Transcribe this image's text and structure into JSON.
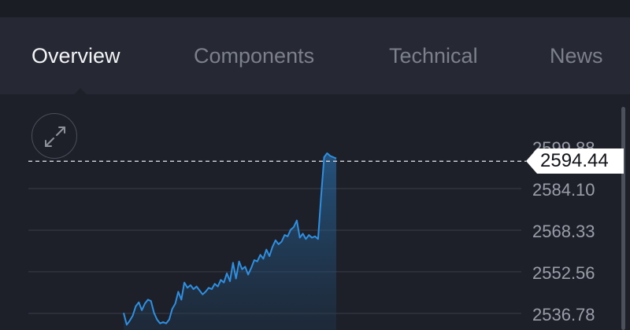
{
  "tabs": [
    {
      "label": "Overview",
      "active": true
    },
    {
      "label": "Components",
      "active": false
    },
    {
      "label": "Technical",
      "active": false
    },
    {
      "label": "News",
      "active": false
    }
  ],
  "chart": {
    "expand_icon": "expand-arrows-icon",
    "current_price": "2594.44",
    "colors": {
      "background": "#1e2029",
      "line": "#2f8fe0",
      "grid": "#3a3e48",
      "axis_text": "#9a9ea8",
      "price_line": "#c8ccd2",
      "price_tag_bg": "#ffffff"
    }
  },
  "chart_data": {
    "type": "area",
    "title": "",
    "xlabel": "",
    "ylabel": "",
    "y_ticks": [
      "2599.88",
      "2584.10",
      "2568.33",
      "2552.56",
      "2536.78"
    ],
    "ylim": [
      2530.0,
      2604.0
    ],
    "current_value": 2594.44,
    "grid": true,
    "series": [
      {
        "x": [
          0,
          1,
          2,
          3,
          4,
          5,
          6,
          7,
          8,
          9,
          10,
          11,
          12,
          13,
          14,
          15,
          16,
          17,
          18,
          19,
          20,
          21,
          22,
          23,
          24,
          25,
          26,
          27,
          28,
          29,
          30,
          31,
          32,
          33,
          34,
          35,
          36,
          37,
          38,
          39,
          40,
          41,
          42,
          43,
          44,
          45,
          46,
          47,
          48,
          49,
          50,
          51,
          52,
          53,
          54,
          55,
          56,
          57,
          58,
          59,
          60,
          61,
          62,
          63,
          64,
          65,
          66,
          67,
          68,
          69,
          70
        ],
        "y": [
          2537.0,
          2532.5,
          2534.0,
          2536.0,
          2539.5,
          2541.0,
          2538.0,
          2540.5,
          2542.0,
          2541.5,
          2537.0,
          2534.5,
          2533.0,
          2533.5,
          2533.0,
          2534.5,
          2538.5,
          2540.5,
          2545.0,
          2542.0,
          2548.5,
          2546.5,
          2547.5,
          2546.0,
          2547.0,
          2545.5,
          2544.0,
          2545.0,
          2546.5,
          2546.0,
          2548.0,
          2547.0,
          2549.5,
          2548.5,
          2552.0,
          2549.0,
          2556.0,
          2550.0,
          2556.5,
          2553.5,
          2554.5,
          2551.5,
          2554.0,
          2557.0,
          2556.5,
          2559.0,
          2557.5,
          2561.0,
          2558.5,
          2562.0,
          2564.5,
          2563.0,
          2564.0,
          2566.5,
          2566.0,
          2568.5,
          2569.5,
          2572.0,
          2565.5,
          2567.0,
          2565.0,
          2566.5,
          2565.5,
          2566.0,
          2565.0,
          2581.0,
          2596.0,
          2597.5,
          2596.5,
          2596.0,
          2595.5
        ]
      }
    ]
  }
}
